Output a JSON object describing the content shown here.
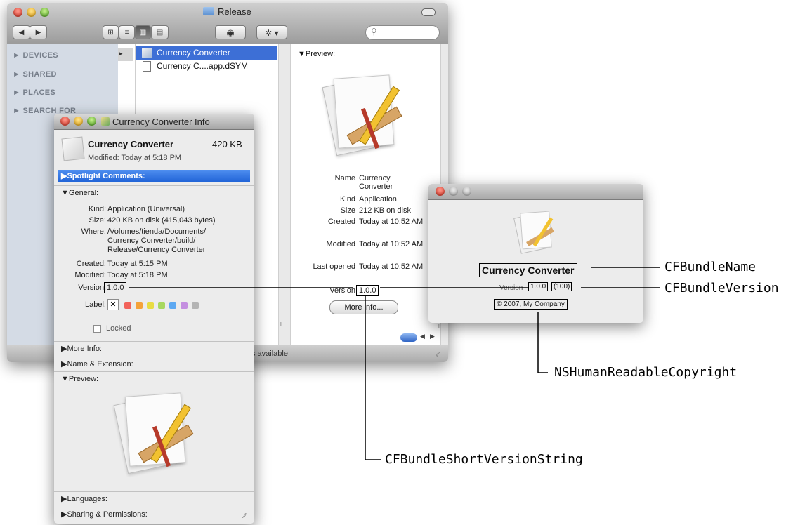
{
  "finder": {
    "title": "Release",
    "view_buttons": [
      "⊞",
      "≡",
      "▥",
      "▤"
    ],
    "sidebar": [
      {
        "label": "DEVICES"
      },
      {
        "label": "SHARED"
      },
      {
        "label": "PLACES"
      },
      {
        "label": "SEARCH FOR"
      }
    ],
    "files": [
      {
        "name": "Currency Converter",
        "selected": true
      },
      {
        "name": "Currency C....app.dSYM",
        "selected": false
      }
    ],
    "preview": {
      "heading": "Preview:",
      "fields": [
        {
          "label": "Name",
          "value": "Currency Converter"
        },
        {
          "label": "Kind",
          "value": "Application"
        },
        {
          "label": "Size",
          "value": "212 KB on disk"
        },
        {
          "label": "Created",
          "value": "Today at 10:52 AM"
        },
        {
          "label": "Modified",
          "value": "Today at 10:52 AM"
        },
        {
          "label": "Last opened",
          "value": "Today at 10:52 AM"
        }
      ],
      "version_label": "Version",
      "version_value": "1.0.0",
      "more_info_label": "More info..."
    },
    "status_text": "s available"
  },
  "info": {
    "title": "Currency Converter Info",
    "name": "Currency Converter",
    "size": "420 KB",
    "modified_summary": "Modified: Today at 5:18 PM",
    "sections": {
      "spotlight": "Spotlight Comments:",
      "general": "General:",
      "more_info": "More Info:",
      "name_ext": "Name & Extension:",
      "preview": "Preview:",
      "languages": "Languages:",
      "sharing": "Sharing & Permissions:"
    },
    "general": {
      "kind_label": "Kind:",
      "kind": "Application (Universal)",
      "size_label": "Size:",
      "size": "420 KB on disk (415,043 bytes)",
      "where_label": "Where:",
      "where": [
        "/Volumes/tienda/Documents/",
        "Currency Converter/build/",
        "Release/Currency Converter"
      ],
      "created_label": "Created:",
      "created": "Today at 5:15 PM",
      "modified_label": "Modified:",
      "modified": "Today at 5:18 PM",
      "version_label": "Version:",
      "version": "1.0.0",
      "label_label": "Label:",
      "label_colors": [
        "#f2625a",
        "#f4a23a",
        "#e8dc43",
        "#a8d860",
        "#5da9f2",
        "#c48fe0",
        "#b4b4b4"
      ],
      "locked_label": "Locked"
    }
  },
  "about": {
    "app_name": "Currency Converter",
    "version_label": "Version",
    "version": "1.0.0",
    "build": "(100)",
    "copyright": "© 2007, My Company"
  },
  "callouts": {
    "bundle_name": "CFBundleName",
    "bundle_version": "CFBundleVersion",
    "copyright_key": "NSHumanReadableCopyright",
    "short_version": "CFBundleShortVersionString"
  }
}
